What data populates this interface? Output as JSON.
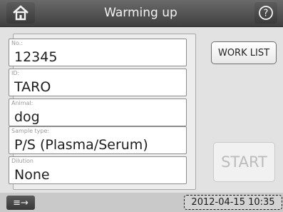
{
  "header": {
    "title": "Warming up",
    "home_icon": "home-icon",
    "help_icon": "help-icon"
  },
  "form": {
    "fields": [
      {
        "label": "No.:",
        "value": "12345"
      },
      {
        "label": "ID:",
        "value": "TARO"
      },
      {
        "label": "Animal:",
        "value": "dog"
      },
      {
        "label": "Sample type:",
        "value": "P/S (Plasma/Serum)"
      },
      {
        "label": "Dilution",
        "value": "None"
      }
    ]
  },
  "buttons": {
    "worklist_label": "WORK LIST",
    "start_label": "START",
    "start_enabled": false
  },
  "footer": {
    "menu_label": "≡→",
    "menu_icon": "menu-arrow-icon",
    "datetime": "2012-04-15 10:35"
  },
  "colors": {
    "header_bg": "#4a4a4a",
    "screen_bg": "#e2e2e2",
    "field_bg": "#ffffff",
    "disabled_text": "#bcbcbc"
  }
}
